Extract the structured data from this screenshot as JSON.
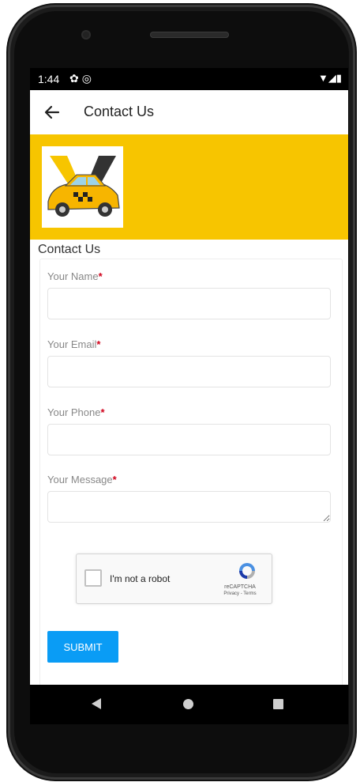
{
  "status_bar": {
    "time": "1:44",
    "left_icons": [
      "gear-icon",
      "at-icon"
    ],
    "right_icons": [
      "wifi-icon",
      "signal-icon",
      "battery-icon"
    ]
  },
  "app_bar": {
    "title": "Contact Us"
  },
  "colors": {
    "banner": "#f7c500",
    "submit": "#0a9cf5",
    "required": "#d0021b"
  },
  "page": {
    "section_title": "Contact Us"
  },
  "form": {
    "name_label": "Your Name",
    "email_label": "Your Email",
    "phone_label": "Your Phone",
    "message_label": "Your Message",
    "required_mark": "*",
    "name_value": "",
    "email_value": "",
    "phone_value": "",
    "message_value": ""
  },
  "recaptcha": {
    "label": "I'm not a robot",
    "brand": "reCAPTCHA",
    "links": "Privacy - Terms"
  },
  "submit_label": "SUBMIT",
  "nav_bar": {
    "icons": [
      "nav-back-icon",
      "nav-home-icon",
      "nav-recent-icon"
    ]
  }
}
